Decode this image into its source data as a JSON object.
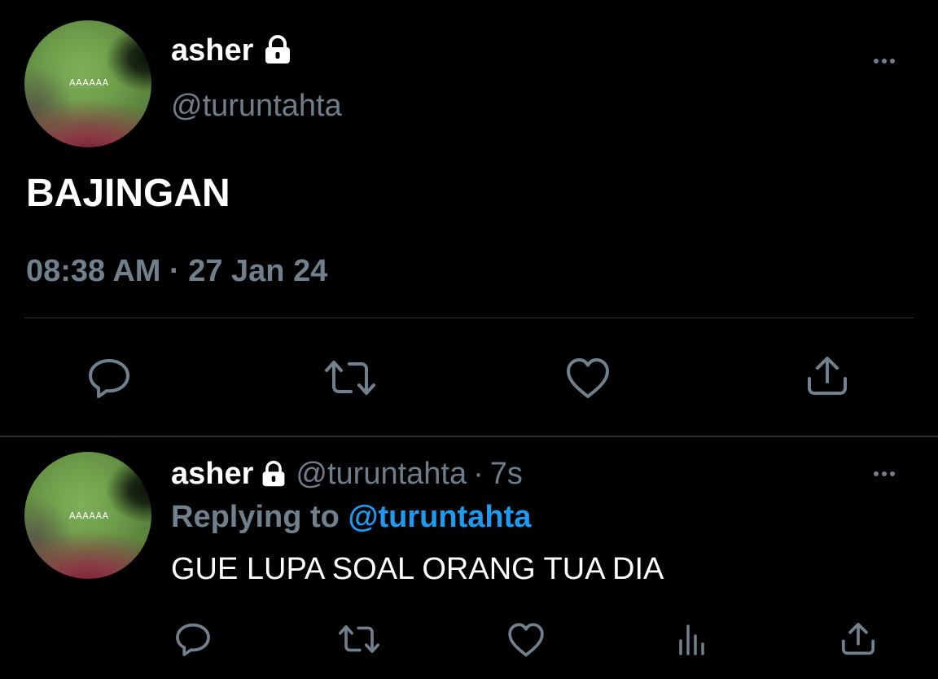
{
  "main_tweet": {
    "author_name": "asher",
    "handle": "@turuntahta",
    "avatar_text": "AAAAAA",
    "body": "BAJINGAN",
    "timestamp": "08:38 AM · 27 Jan 24",
    "actions": [
      "reply-icon",
      "retweet-icon",
      "like-icon",
      "share-icon"
    ]
  },
  "reply_tweet": {
    "author_name": "asher",
    "handle": "@turuntahta",
    "separator": "·",
    "time": "7s",
    "avatar_text": "AAAAAA",
    "replying_prefix": "Replying to",
    "replying_handle": "@turuntahta",
    "body": "GUE LUPA SOAL ORANG TUA DIA",
    "actions": [
      "reply-icon",
      "retweet-icon",
      "like-icon",
      "analytics-icon",
      "share-icon"
    ]
  },
  "colors": {
    "background": "#000000",
    "text": "#ffffff",
    "muted": "#71808d",
    "accent": "#1d9bf0",
    "divider": "#2f3336"
  }
}
